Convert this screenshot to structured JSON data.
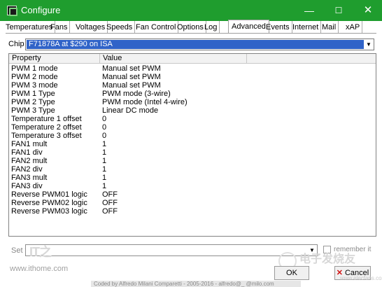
{
  "window": {
    "title": "Configure",
    "controls": {
      "minimize": "—",
      "maximize": "☐",
      "close": "✕"
    }
  },
  "tabs": [
    "Temperatures",
    "Fans",
    "Voltages",
    "Speeds",
    "Fan Control",
    "Options",
    "Log",
    "Advanced",
    "Events",
    "Internet",
    "Mail",
    "xAP"
  ],
  "active_tab": "Advanced",
  "chip": {
    "label": "Chip",
    "value": "F71878A at $290 on ISA"
  },
  "table": {
    "columns": [
      "Property",
      "Value"
    ],
    "rows": [
      {
        "property": "PWM 1 mode",
        "value": "Manual set PWM"
      },
      {
        "property": "PWM 2 mode",
        "value": "Manual set PWM"
      },
      {
        "property": "PWM 3 mode",
        "value": "Manual set PWM"
      },
      {
        "property": "PWM 1 Type",
        "value": "PWM mode (3-wire)"
      },
      {
        "property": "PWM 2 Type",
        "value": "PWM mode (Intel 4-wire)"
      },
      {
        "property": "PWM 3 Type",
        "value": "Linear DC mode"
      },
      {
        "property": "Temperature 1 offset",
        "value": "0"
      },
      {
        "property": "Temperature 2 offset",
        "value": "0"
      },
      {
        "property": "Temperature 3 offset",
        "value": "0"
      },
      {
        "property": "FAN1 mult",
        "value": "1"
      },
      {
        "property": "FAN1 div",
        "value": "1"
      },
      {
        "property": "FAN2 mult",
        "value": "1"
      },
      {
        "property": "FAN2 div",
        "value": "1"
      },
      {
        "property": "FAN3 mult",
        "value": "1"
      },
      {
        "property": "FAN3 div",
        "value": "1"
      },
      {
        "property": "Reverse PWM01 logic",
        "value": "OFF"
      },
      {
        "property": "Reverse PWM02 logic",
        "value": "OFF"
      },
      {
        "property": "Reverse PWM03 logic",
        "value": "OFF"
      }
    ]
  },
  "set_to": {
    "label": "Set to",
    "value": ""
  },
  "remember": {
    "label": "remember it",
    "checked": false
  },
  "buttons": {
    "ok": "OK",
    "cancel": "Cancel"
  },
  "footer_text": "Coded by Alfredo Milani Comparetti - 2005-2016 - alfredo@_ @milo.com",
  "watermark": {
    "left_url": "www.ithome.com",
    "logo_text": "IT之",
    "right_text": "电子发烧友",
    "right_url": "www.elecfans.com"
  },
  "colors": {
    "titlebar": "#1f9d2e",
    "selection": "#3063c8",
    "cancel_icon": "#d01010"
  }
}
